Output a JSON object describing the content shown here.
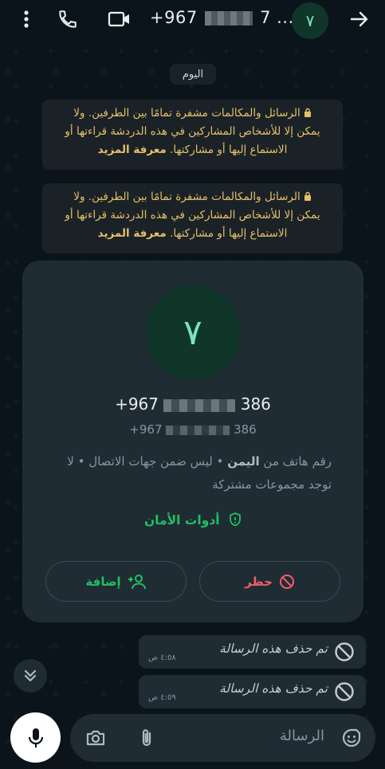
{
  "header": {
    "title_prefix": "+967",
    "title_suffix": "7 ...",
    "avatar_letter": "٧",
    "icons": [
      "more-vert-icon",
      "phone-call-icon",
      "video-call-icon",
      "back-arrow-icon"
    ]
  },
  "date_chip": "اليوم",
  "notices": [
    {
      "line1": "الرسائل والمكالمات مشفرة تمامًا بين الطرفين. ولا",
      "line2": "يمكن إلا للأشخاص المشاركين في هذه الدردشة قراءتها أو",
      "line3": "الاستماع إليها أو مشاركتها.",
      "more": "معرفة المزيد"
    },
    {
      "line1": "الرسائل والمكالمات مشفرة تمامًا بين الطرفين. ولا",
      "line2": "يمكن إلا للأشخاص المشاركين في هذه الدردشة قراءتها أو",
      "line3": "الاستماع إليها أو مشاركتها.",
      "more": "معرفة المزيد"
    }
  ],
  "contact_card": {
    "avatar_letter": "٧",
    "phone_prefix": "+967",
    "phone_suffix": "386",
    "phone2_prefix": "+967",
    "phone2_suffix": "386",
    "info_part1": "رقم هاتف من ",
    "info_country": "اليمن",
    "info_part2": " • ليس ضمن جهات الاتصال • لا توجد مجموعات مشتركة",
    "security_label": "أدوات الأمان",
    "block_label": "حظر",
    "add_label": "إضافة"
  },
  "messages": [
    {
      "text": "تم حذف هذه الرسالة",
      "time": "٤:٥٨ ص"
    },
    {
      "text": "تم حذف هذه الرسالة",
      "time": "٤:٥٩ ص"
    }
  ],
  "composer": {
    "placeholder": "الرسالة"
  },
  "colors": {
    "background": "#0b141a",
    "bubble": "#1f2c34",
    "accent_green": "#21c063",
    "danger_red": "#f15c6d",
    "notice_text": "#e5c069"
  }
}
